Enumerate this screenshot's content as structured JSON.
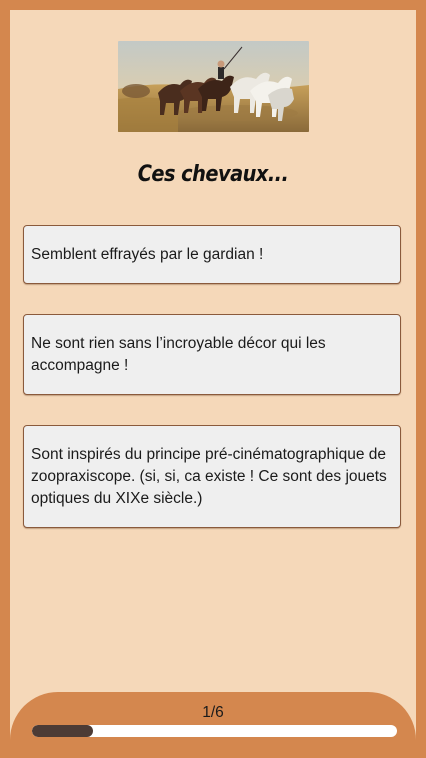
{
  "quiz": {
    "image_alt": "horses painting",
    "question": "Ces chevaux...",
    "answers": [
      {
        "label": "Semblent effrayés par le gardian !"
      },
      {
        "label": "Ne sont rien sans l’incroyable décor qui les accompagne !"
      },
      {
        "label": "Sont inspirés du principe pré-cinématographique de zoopraxiscope. (si, si, ca existe ! Ce sont des jouets optiques du XIXe siècle.)"
      }
    ]
  },
  "progress": {
    "counter_text": "1/6",
    "current": 1,
    "total": 6,
    "fraction": 0.167
  },
  "colors": {
    "outer_frame": "#d4874e",
    "background": "#f5d8b9",
    "answer_background": "#efefef",
    "answer_border": "#8a5a3c",
    "progress_fill": "#4c3b35",
    "progress_track": "#ffffff"
  }
}
